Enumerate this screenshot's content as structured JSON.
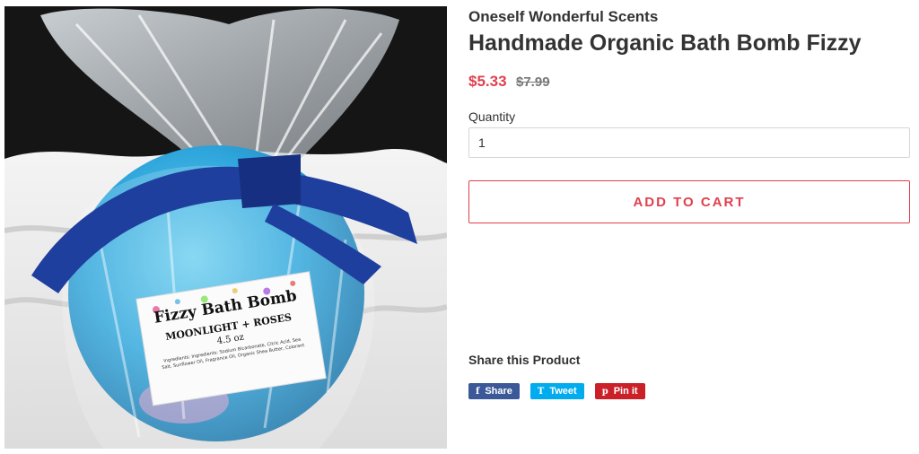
{
  "product": {
    "vendor": "Oneself Wonderful Scents",
    "title": "Handmade Organic Bath Bomb Fizzy",
    "price_sale": "$5.33",
    "price_compare": "$7.99",
    "image_label": {
      "line1": "Fizzy Bath Bomb",
      "line2": "Moonlight + Roses",
      "line3": "4.5 oz",
      "ingredients": "Ingredients: Ingredients: Sodium Bicarbonate, Citric Acid, Sea Salt, Sunflower Oil, Fragrance Oil, Organic Shea Butter, Colorant"
    }
  },
  "form": {
    "quantity_label": "Quantity",
    "quantity_value": "1",
    "add_to_cart_label": "ADD TO CART"
  },
  "share": {
    "heading": "Share this Product",
    "buttons": [
      {
        "icon": "f",
        "label": "Share",
        "color": "#3b5998",
        "icon_name": "facebook-icon"
      },
      {
        "icon": "T",
        "label": "Tweet",
        "color": "#00aced",
        "icon_name": "twitter-icon"
      },
      {
        "icon": "p",
        "label": "Pin it",
        "color": "#cb2027",
        "icon_name": "pinterest-icon"
      }
    ]
  },
  "colors": {
    "accent": "#e0404e",
    "text": "#333333",
    "muted": "#777777"
  }
}
